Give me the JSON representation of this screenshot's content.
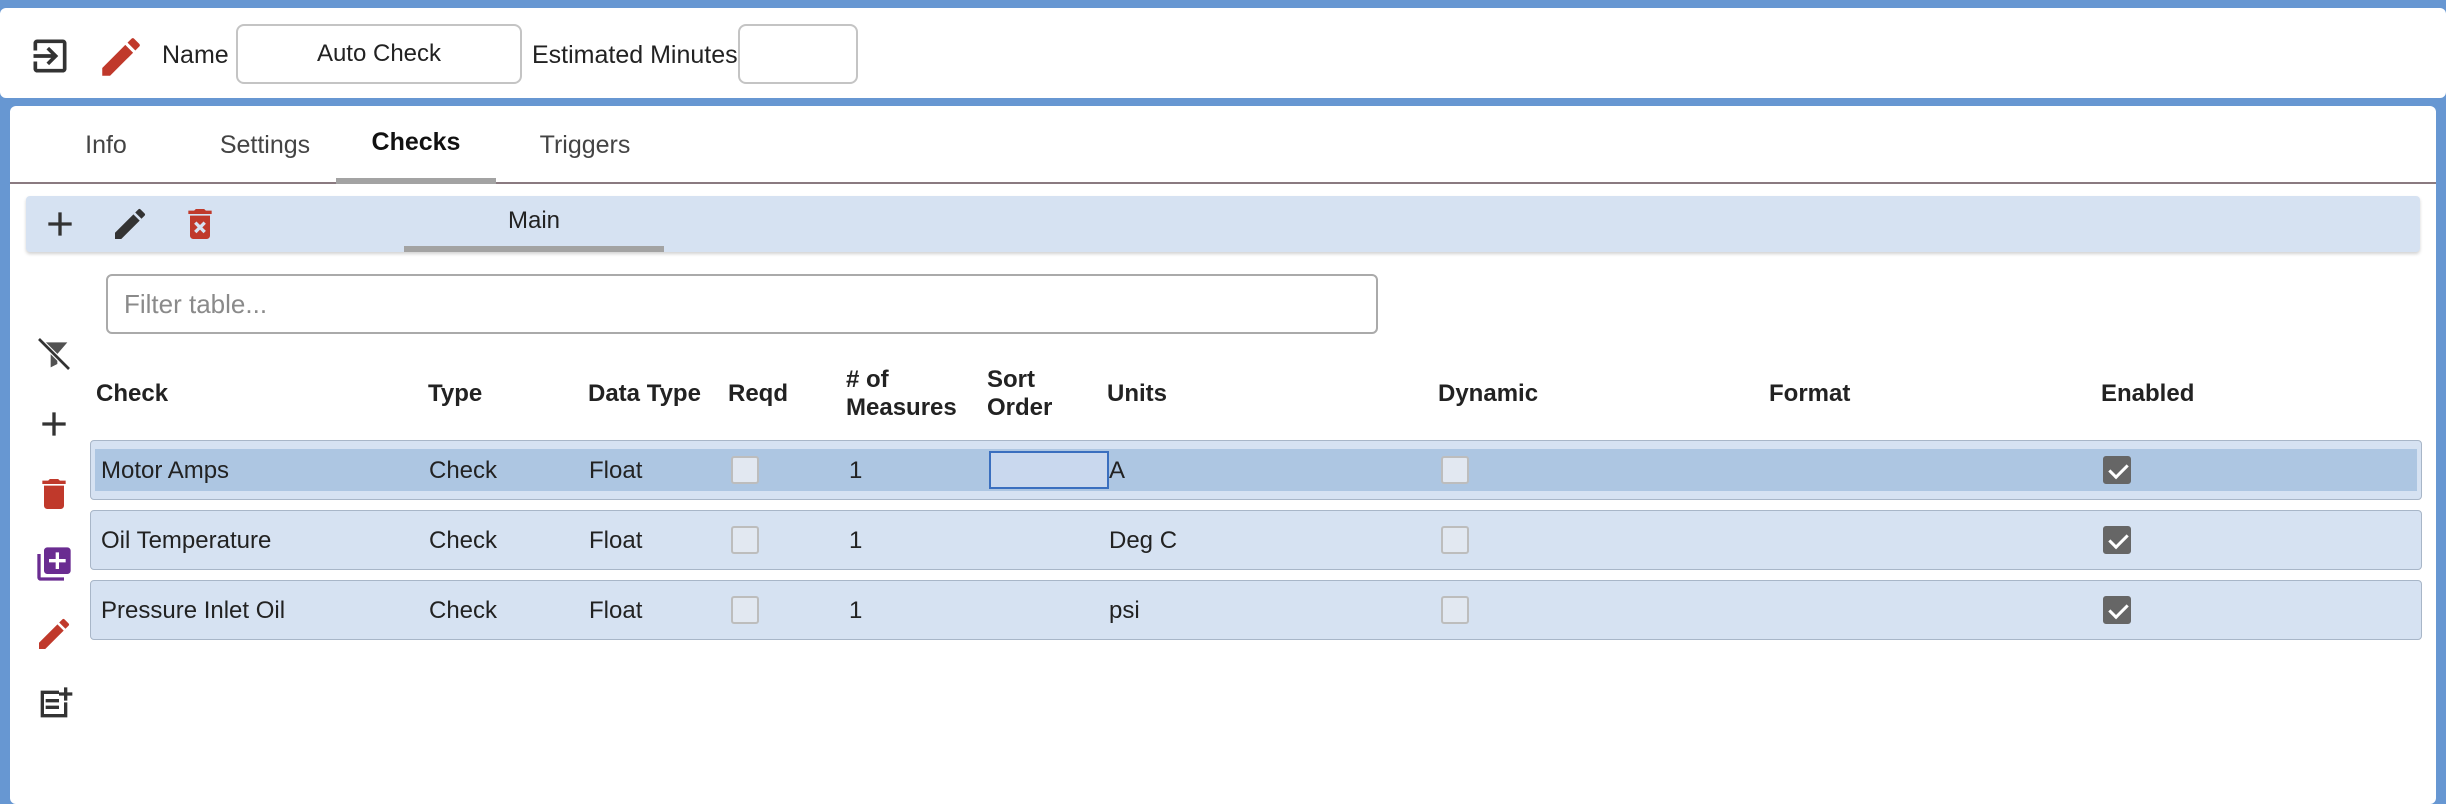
{
  "header": {
    "name_label": "Name",
    "name_value": "Auto Check",
    "minutes_label": "Estimated Minutes",
    "minutes_value": ""
  },
  "tabs": [
    {
      "label": "Info",
      "active": false
    },
    {
      "label": "Settings",
      "active": false
    },
    {
      "label": "Checks",
      "active": true
    },
    {
      "label": "Triggers",
      "active": false
    }
  ],
  "subtabs": [
    {
      "label": "Main",
      "active": true
    }
  ],
  "filter": {
    "placeholder": "Filter table...",
    "value": ""
  },
  "table": {
    "headers": {
      "check": "Check",
      "type": "Type",
      "data_type": "Data Type",
      "reqd": "Reqd",
      "measures_1": "# of",
      "measures_2": "Measures",
      "sort_1": "Sort",
      "sort_2": "Order",
      "units": "Units",
      "dynamic": "Dynamic",
      "format": "Format",
      "enabled": "Enabled"
    },
    "rows": [
      {
        "check": "Motor Amps",
        "type": "Check",
        "data_type": "Float",
        "reqd": false,
        "measures": "1",
        "sort_order": "",
        "units": "A",
        "dynamic": false,
        "format": "",
        "enabled": true,
        "selected": true
      },
      {
        "check": "Oil Temperature",
        "type": "Check",
        "data_type": "Float",
        "reqd": false,
        "measures": "1",
        "sort_order": "",
        "units": "Deg C",
        "dynamic": false,
        "format": "",
        "enabled": true,
        "selected": false
      },
      {
        "check": "Pressure Inlet Oil",
        "type": "Check",
        "data_type": "Float",
        "reqd": false,
        "measures": "1",
        "sort_order": "",
        "units": "psi",
        "dynamic": false,
        "format": "",
        "enabled": true,
        "selected": false
      }
    ]
  },
  "icons": {
    "exit": "exit-icon",
    "edit": "pencil-icon",
    "add": "plus-icon",
    "delete": "trash-icon",
    "clear_filter": "filter-off-icon",
    "add_library": "library-add-icon",
    "note_add": "note-add-icon"
  },
  "colors": {
    "frame": "#6797d2",
    "row": "#d6e2f2",
    "row_selected": "#adc6e2",
    "danger": "#c0392b",
    "purple": "#6a2c91"
  }
}
